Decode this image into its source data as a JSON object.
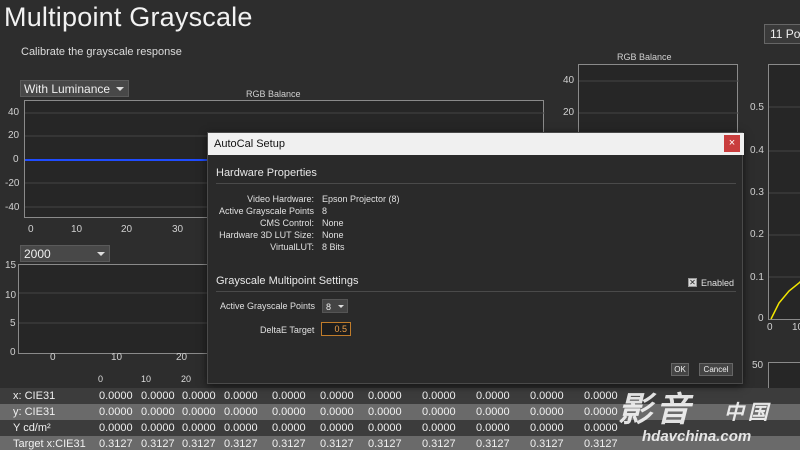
{
  "page": {
    "title": "Multipoint Grayscale",
    "subtitle": "Calibrate the grayscale response"
  },
  "left_panel": {
    "mode_dropdown": "With Luminance",
    "rgb_chart_title": "RGB Balance",
    "rgb_y_ticks": [
      "40",
      "20",
      "0",
      "-20",
      "-40"
    ],
    "rgb_x_ticks": [
      "0",
      "10",
      "20",
      "30"
    ],
    "dE_dropdown": "2000",
    "dE_y_ticks": [
      "15",
      "10",
      "5",
      "0"
    ],
    "dE_x_ticks": [
      "0",
      "10",
      "20"
    ],
    "colors": {
      "blue_line": "#1f4cff"
    }
  },
  "middle_panel": {
    "rgb_chart_title": "RGB Balance",
    "y_ticks": [
      "40",
      "20"
    ]
  },
  "right_panel": {
    "tab_label": "11 Po",
    "y_ticks": [
      "0.5",
      "0.4",
      "0.3",
      "0.2",
      "0.1",
      "0"
    ],
    "x_ticks": [
      "0",
      "10"
    ],
    "lower_tick": "50",
    "colors": {
      "curve": "#f2e600"
    }
  },
  "table": {
    "column_headers": [
      "0",
      "10",
      "20"
    ],
    "rows": [
      {
        "label": "x: CIE31",
        "values": [
          "0.0000",
          "0.0000",
          "0.0000",
          "0.0000",
          "0.0000",
          "0.0000",
          "0.0000",
          "0.0000",
          "0.0000",
          "0.0000",
          "0.0000"
        ]
      },
      {
        "label": "y: CIE31",
        "values": [
          "0.0000",
          "0.0000",
          "0.0000",
          "0.0000",
          "0.0000",
          "0.0000",
          "0.0000",
          "0.0000",
          "0.0000",
          "0.0000",
          "0.0000"
        ]
      },
      {
        "label": "Y cd/m²",
        "values": [
          "0.0000",
          "0.0000",
          "0.0000",
          "0.0000",
          "0.0000",
          "0.0000",
          "0.0000",
          "0.0000",
          "0.0000",
          "0.0000",
          "0.0000"
        ]
      },
      {
        "label": "Target x:CIE31",
        "values": [
          "0.3127",
          "0.3127",
          "0.3127",
          "0.3127",
          "0.3127",
          "0.3127",
          "0.3127",
          "0.3127",
          "0.3127",
          "0.3127",
          "0.3127"
        ]
      }
    ]
  },
  "dialog": {
    "title": "AutoCal Setup",
    "close": "×",
    "hardware_section": "Hardware Properties",
    "properties": [
      {
        "label": "Video Hardware:",
        "value": "Epson Projector (8)"
      },
      {
        "label": "Active Grayscale Points",
        "value": "8"
      },
      {
        "label": "CMS Control:",
        "value": "None"
      },
      {
        "label": "Hardware 3D LUT Size:",
        "value": "None"
      },
      {
        "label": "VirtualLUT:",
        "value": "8 Bits"
      }
    ],
    "grayscale_section": "Grayscale Multipoint Settings",
    "enabled_label": "Enabled",
    "enabled_check": "✕",
    "active_points_label": "Active Grayscale Points",
    "active_points_value": "8",
    "delta_label": "DeltaE Target",
    "delta_value": "0.5",
    "ok": "OK",
    "cancel": "Cancel"
  },
  "watermark": {
    "top": "影音",
    "middle": "中国",
    "bottom": "hdavchina.com"
  }
}
